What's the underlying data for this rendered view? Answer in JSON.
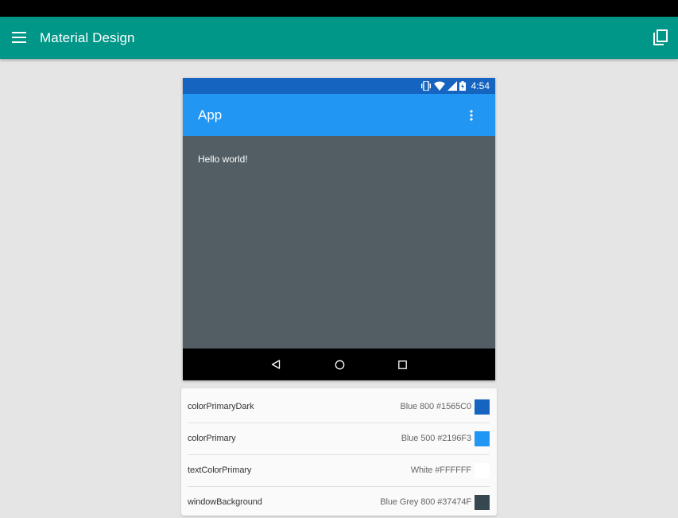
{
  "app_bar": {
    "title": "Material Design",
    "menu_icon": "menu-icon",
    "copy_icon": "copy-icon",
    "background": "#009688"
  },
  "phone": {
    "status_bar": {
      "time": "4:54",
      "background": "#1565C0",
      "icons": [
        "vibrate-icon",
        "wifi-icon",
        "signal-icon",
        "battery-charging-icon"
      ]
    },
    "toolbar": {
      "title": "App",
      "background": "#2196F3",
      "overflow_icon": "more-vert-icon"
    },
    "content": {
      "text": "Hello world!",
      "background": "#525E63"
    },
    "nav_bar": {
      "icons": [
        "back-icon",
        "home-icon",
        "recents-icon"
      ]
    }
  },
  "color_list": [
    {
      "name": "colorPrimaryDark",
      "value": "Blue 800 #1565C0",
      "color": "#1565C0"
    },
    {
      "name": "colorPrimary",
      "value": "Blue 500 #2196F3",
      "color": "#2196F3"
    },
    {
      "name": "textColorPrimary",
      "value": "White #FFFFFF",
      "color": "#FFFFFF"
    },
    {
      "name": "windowBackground",
      "value": "Blue Grey 800 #37474F",
      "color": "#37474F"
    }
  ]
}
